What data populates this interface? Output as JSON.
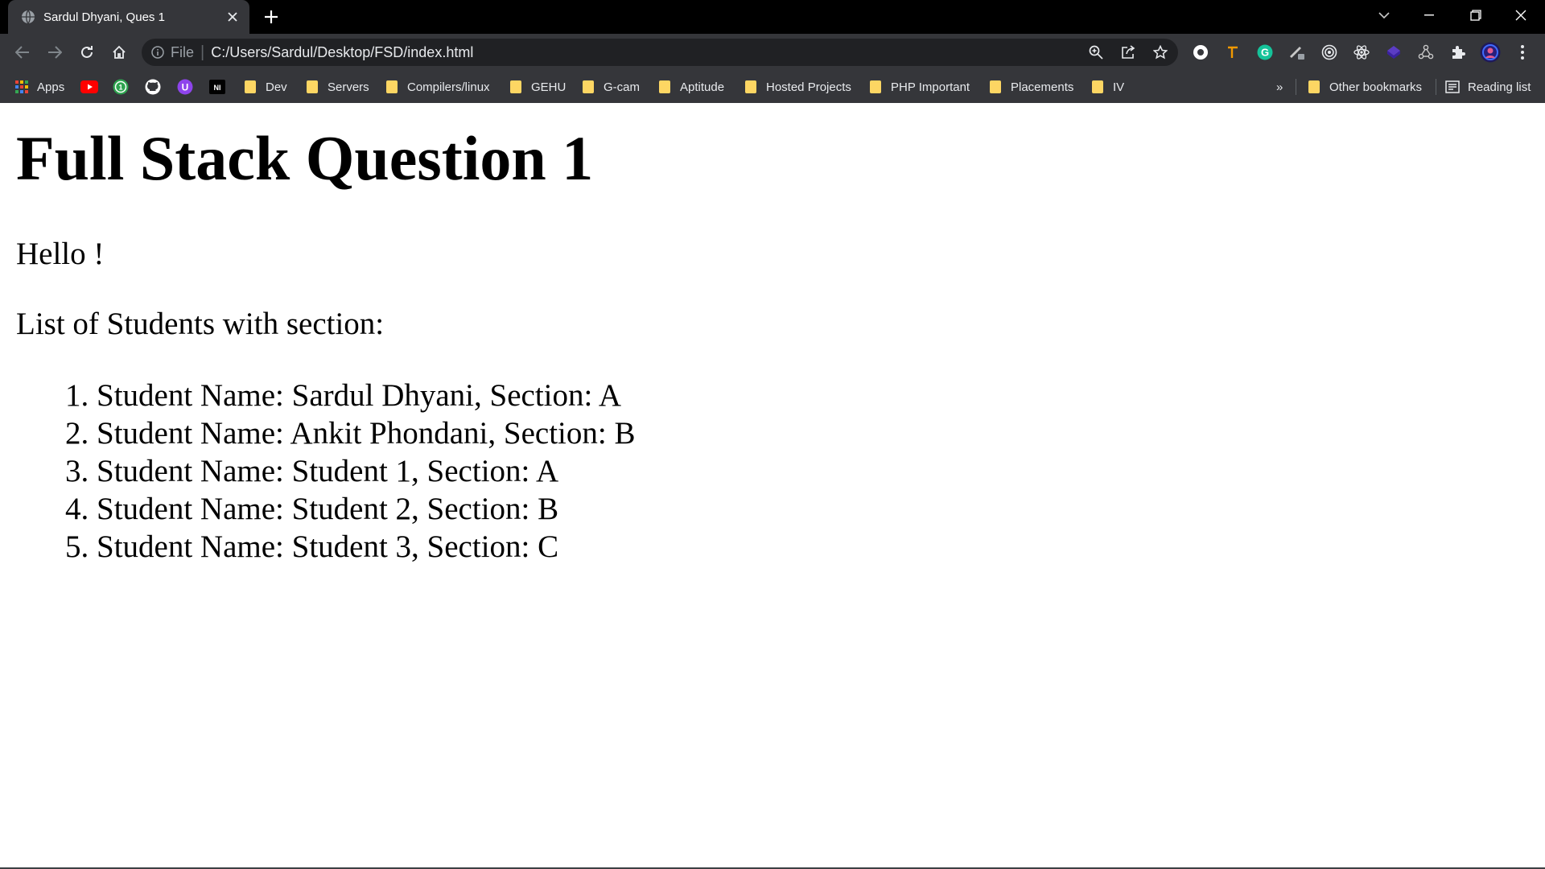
{
  "browser": {
    "tab": {
      "title": "Sardul Dhyani, Ques 1",
      "favicon": "globe-icon"
    },
    "address_bar": {
      "scheme": "File",
      "url": "C:/Users/Sardul/Desktop/FSD/index.html"
    },
    "colors": {
      "titlebar": "#000000",
      "toolbar": "#35363a",
      "omnibox": "#202124",
      "folder": "#fdd663"
    },
    "extensions": [
      "grammarly-icon",
      "pen-icon",
      "target-icon",
      "react-devtools-icon",
      "cube-icon",
      "nodes-icon",
      "puzzle-icon"
    ],
    "bookmarks": {
      "apps_label": "Apps",
      "folders": [
        "Dev",
        "Servers",
        "Compilers/linux",
        "GEHU",
        "G-cam",
        "Aptitude",
        "Hosted Projects",
        "PHP Important",
        "Placements",
        "IV"
      ],
      "overflow": "»",
      "other": "Other bookmarks",
      "reading_list": "Reading list"
    }
  },
  "page": {
    "heading": "Full Stack Question 1",
    "greeting": "Hello !",
    "list_intro": "List of Students with section:",
    "students": [
      "Student Name: Sardul Dhyani, Section: A",
      "Student Name: Ankit Phondani, Section: B",
      "Student Name: Student 1, Section: A",
      "Student Name: Student 2, Section: B",
      "Student Name: Student 3, Section: C"
    ]
  }
}
